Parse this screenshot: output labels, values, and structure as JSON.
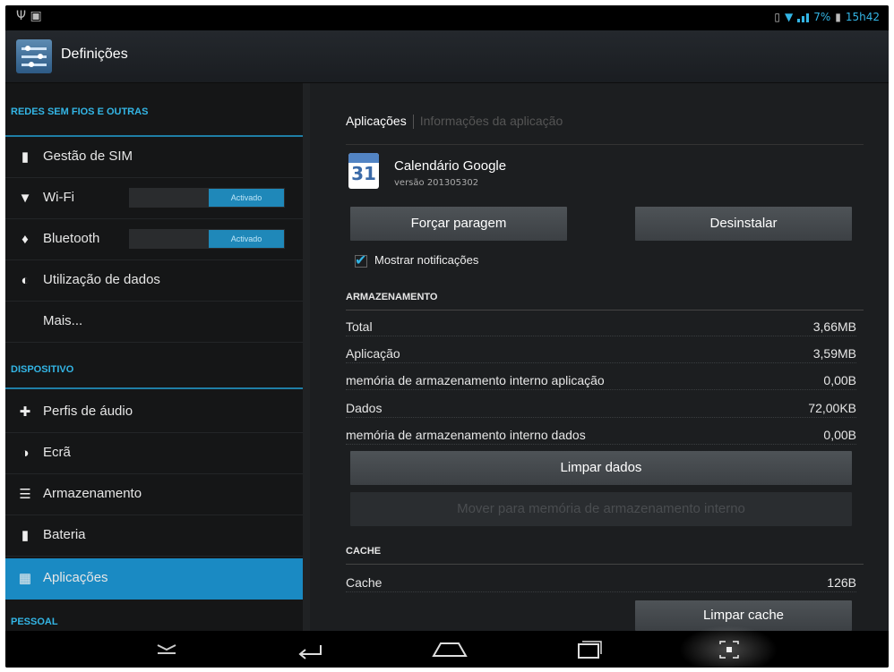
{
  "status_bar": {
    "battery": "7%",
    "time": "15h42"
  },
  "action_bar": {
    "title": "Definições"
  },
  "sidebar": {
    "section_wireless": "REDES SEM FIOS E OUTRAS",
    "section_device": "DISPOSITIVO",
    "section_personal": "PESSOAL",
    "items": [
      {
        "label": "Gestão de SIM",
        "icon": "sim-icon"
      },
      {
        "label": "Wi-Fi",
        "icon": "wifi-icon",
        "toggle": "Activado"
      },
      {
        "label": "Bluetooth",
        "icon": "bluetooth-icon",
        "toggle": "Activado"
      },
      {
        "label": "Utilização de dados",
        "icon": "data-usage-icon"
      },
      {
        "label": "Mais...",
        "icon": ""
      },
      {
        "label": "Perfis de áudio",
        "icon": "audio-profile-icon"
      },
      {
        "label": "Ecrã",
        "icon": "display-icon"
      },
      {
        "label": "Armazenamento",
        "icon": "storage-icon"
      },
      {
        "label": "Bateria",
        "icon": "battery-icon"
      },
      {
        "label": "Aplicações",
        "icon": "apps-icon",
        "active": true
      }
    ]
  },
  "main": {
    "tab_active": "Aplicações",
    "tab_inactive": "Informações da aplicação",
    "app_name": "Calendário Google",
    "app_version": "versão 201305302",
    "calendar_number": "31",
    "force_stop_label": "Forçar paragem",
    "uninstall_label": "Desinstalar",
    "show_notifications_label": "Mostrar notificações",
    "storage_header": "ARMAZENAMENTO",
    "storage_rows": [
      {
        "label": "Total",
        "value": "3,66MB"
      },
      {
        "label": "Aplicação",
        "value": "3,59MB"
      },
      {
        "label": "memória de armazenamento interno aplicação",
        "value": "0,00B"
      },
      {
        "label": "Dados",
        "value": "72,00KB"
      },
      {
        "label": "memória de armazenamento interno dados",
        "value": "0,00B"
      }
    ],
    "clear_data_label": "Limpar dados",
    "move_label": "Mover para memória de armazenamento interno",
    "cache_header": "CACHE",
    "cache_row": {
      "label": "Cache",
      "value": "126B"
    },
    "clear_cache_label": "Limpar cache"
  },
  "colors": {
    "accent": "#33b5e5",
    "active_item": "#1a8ac3"
  }
}
